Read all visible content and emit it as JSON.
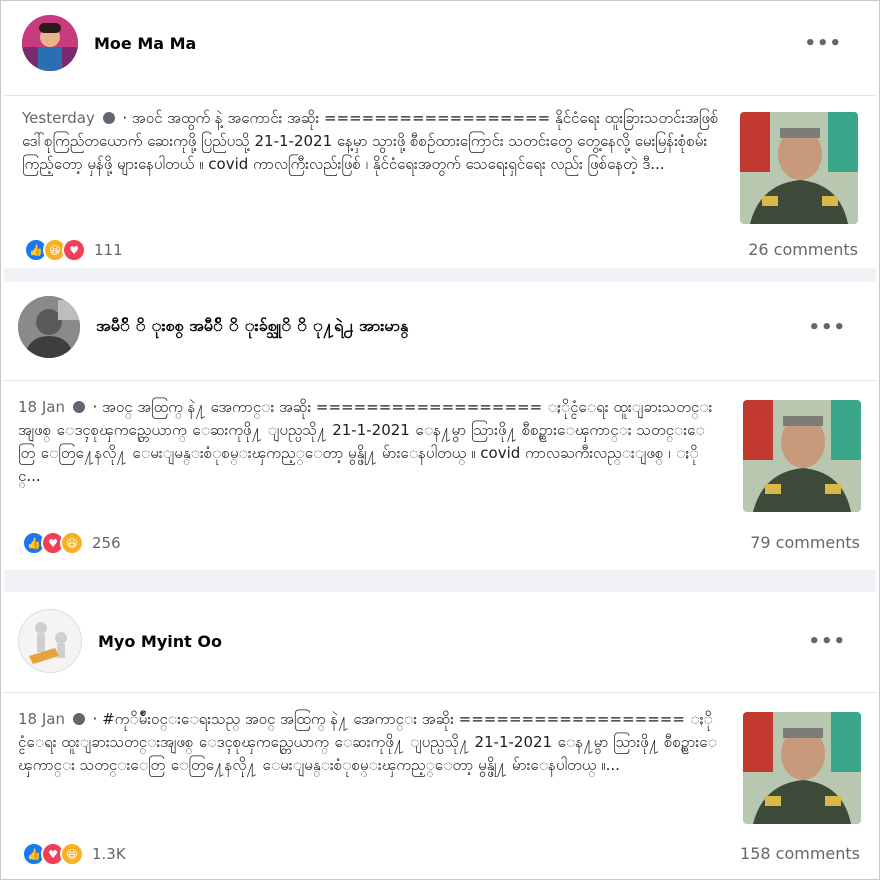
{
  "posts": [
    {
      "author": "Moe Ma Ma",
      "meta_time": "Yesterday",
      "text": "· အဝင် အထွက် နဲ့ အကောင်း အဆိုး ================== နိုင်ငံရေး ထူးခြားသတင်းအဖြစ် ဒေါ်စုကြည်တယောက် ဆေးကုဖို့ ပြည်ပသို့ 21-1-2021 နေ့မှာ သွားဖို့ စီစဉ်ထားကြောင်း သတင်းတွေ တွေ့နေလို့ မေးမြန်းစုံစမ်းကြည့်တော့ မှန်ဖို့ များနေပါတယ် ။ covid ကာလကြီးလည်းဖြစ် ၊ နိုင်ငံရေးအတွက် သေရေးရှင်ရေး လည်း ဖြစ်နေတဲ့ ဒီ...",
      "reactions": [
        "like",
        "haha",
        "love"
      ],
      "reaction_count": "111",
      "comments": "26 comments"
    },
    {
      "author": "အမီ်ိ ိ ုးစစ္ အမီ်ိ ိ ုးခ်စ္သူိ ိ ု႔ရဲ႕ အားမာန္",
      "meta_time": "18 Jan",
      "text": "· အဝင္ အထြက္ နဲ႔ အေကာင္း အဆိုး ================== ႏိုင္ငံေရး ထူးျခားသတင္းအျဖစ္ ေဒၚစုၾကည္တေယာက္ ေဆးကုဖို႔ ျပည္ပသို႔ 21-1-2021 ေန႔မွာ သြားဖို႔ စီစဥ္ထားေၾကာင္း သတင္းေတြ ေတြ႔ေနလို႔ ေမးျမန္းစံုစမ္းၾကည့္ေတာ့ မွန္ဖို႔ မ်ားေနပါတယ္ ။ covid ကာလႀကီးလည္းျဖစ္ ၊ ႏိုင္...",
      "reactions": [
        "like",
        "love",
        "haha"
      ],
      "reaction_count": "256",
      "comments": "79 comments"
    },
    {
      "author": "Myo Myint Oo",
      "meta_time": "18 Jan",
      "text": "· #ကုိမ်ဳိးဝင္းေရးသည္ အဝင္ အထြက္ နဲ႔ အေကာင္း အဆိုး ================== ႏိုင္ငံေရး ထူးျခားသတင္းအျဖစ္ ေဒၚစုၾကည္တေယာက္ ေဆးကုဖို႔ ျပည္ပသို႔ 21-1-2021 ေန႔မွာ သြားဖို႔ စီစဥ္ထားေၾကာင္း သတင္းေတြ ေတြ႔ေနလို႔ ေမးျမန္းစံုစမ္းၾကည့္ေတာ့ မွန္ဖို႔ မ်ားေနပါတယ္ ။...",
      "reactions": [
        "like",
        "love",
        "haha"
      ],
      "reaction_count": "1.3K",
      "comments": "158 comments"
    }
  ],
  "more_label": "•••",
  "colors": {
    "like": "#1877f2",
    "love": "#f33e58",
    "haha": "#f7b125"
  }
}
